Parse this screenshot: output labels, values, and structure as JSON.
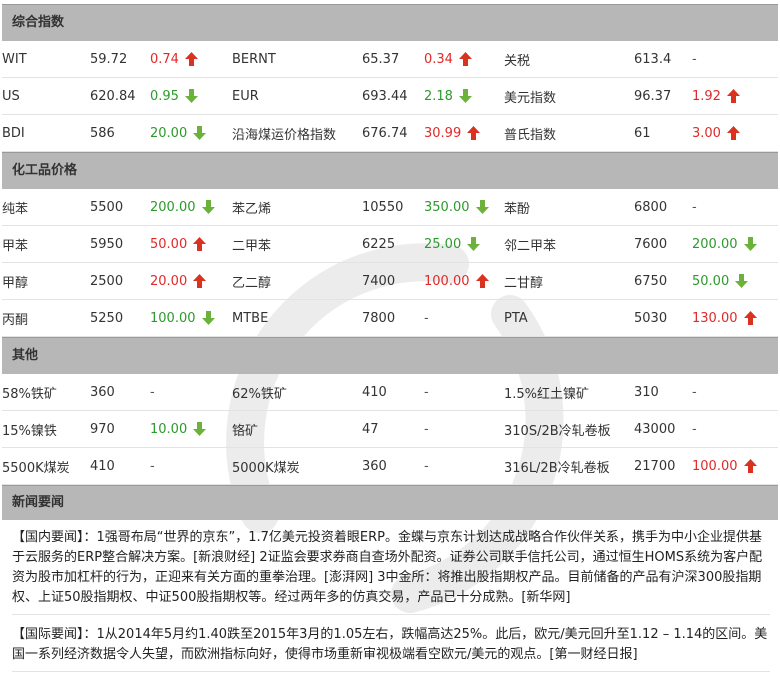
{
  "sections": {
    "composite": {
      "title": "综合指数",
      "rows": [
        [
          {
            "name": "WIT",
            "value": "59.72",
            "change": "0.74",
            "dir": "up"
          },
          {
            "name": "BERNT",
            "value": "65.37",
            "change": "0.34",
            "dir": "up"
          },
          {
            "name": "关税",
            "value": "613.4",
            "change": "-",
            "dir": "none"
          }
        ],
        [
          {
            "name": "US",
            "value": "620.84",
            "change": "0.95",
            "dir": "down"
          },
          {
            "name": "EUR",
            "value": "693.44",
            "change": "2.18",
            "dir": "down"
          },
          {
            "name": "美元指数",
            "value": "96.37",
            "change": "1.92",
            "dir": "up"
          }
        ],
        [
          {
            "name": "BDI",
            "value": "586",
            "change": "20.00",
            "dir": "down"
          },
          {
            "name": "沿海煤运价格指数",
            "value": "676.74",
            "change": "30.99",
            "dir": "up"
          },
          {
            "name": "普氏指数",
            "value": "61",
            "change": "3.00",
            "dir": "up"
          }
        ]
      ]
    },
    "chemicals": {
      "title": "化工品价格",
      "rows": [
        [
          {
            "name": "纯苯",
            "value": "5500",
            "change": "200.00",
            "dir": "down"
          },
          {
            "name": "苯乙烯",
            "value": "10550",
            "change": "350.00",
            "dir": "down"
          },
          {
            "name": "苯酚",
            "value": "6800",
            "change": "-",
            "dir": "none"
          }
        ],
        [
          {
            "name": "甲苯",
            "value": "5950",
            "change": "50.00",
            "dir": "up"
          },
          {
            "name": "二甲苯",
            "value": "6225",
            "change": "25.00",
            "dir": "down"
          },
          {
            "name": "邻二甲苯",
            "value": "7600",
            "change": "200.00",
            "dir": "down"
          }
        ],
        [
          {
            "name": "甲醇",
            "value": "2500",
            "change": "20.00",
            "dir": "up"
          },
          {
            "name": "乙二醇",
            "value": "7400",
            "change": "100.00",
            "dir": "up"
          },
          {
            "name": "二甘醇",
            "value": "6750",
            "change": "50.00",
            "dir": "down"
          }
        ],
        [
          {
            "name": "丙酮",
            "value": "5250",
            "change": "100.00",
            "dir": "down"
          },
          {
            "name": "MTBE",
            "value": "7800",
            "change": "-",
            "dir": "none"
          },
          {
            "name": "PTA",
            "value": "5030",
            "change": "130.00",
            "dir": "up"
          }
        ]
      ]
    },
    "other": {
      "title": "其他",
      "rows": [
        [
          {
            "name": "58%铁矿",
            "value": "360",
            "change": "-",
            "dir": "none"
          },
          {
            "name": "62%铁矿",
            "value": "410",
            "change": "-",
            "dir": "none"
          },
          {
            "name": "1.5%红土镍矿",
            "value": "310",
            "change": "-",
            "dir": "none"
          }
        ],
        [
          {
            "name": "15%镍铁",
            "value": "970",
            "change": "10.00",
            "dir": "down"
          },
          {
            "name": "铬矿",
            "value": "47",
            "change": "-",
            "dir": "none"
          },
          {
            "name": "310S/2B冷轧卷板",
            "value": "43000",
            "change": "-",
            "dir": "none"
          }
        ],
        [
          {
            "name": "5500K煤炭",
            "value": "410",
            "change": "-",
            "dir": "none"
          },
          {
            "name": "5000K煤炭",
            "value": "360",
            "change": "-",
            "dir": "none"
          },
          {
            "name": "316L/2B冷轧卷板",
            "value": "21700",
            "change": "100.00",
            "dir": "up"
          }
        ]
      ]
    }
  },
  "news": {
    "title": "新闻要闻",
    "paragraphs": [
      "【国内要闻】：1强哥布局“世界的京东”，1.7亿美元投资着眼ERP。金蝶与京东计划达成战略合作伙伴关系，携手为中小企业提供基于云服务的ERP整合解决方案。[新浪财经] 2证监会要求券商自查场外配资。证券公司联手信托公司，通过恒生HOMS系统为客户配资为股市加杠杆的行为，正迎来有关方面的重拳治理。[澎湃网] 3中金所：将推出股指期权产品。目前储备的产品有沪深300股指期权、上证50股指期权、中证500股指期权等。经过两年多的仿真交易，产品已十分成熟。[新华网]",
      "【国际要闻】：1从2014年5月约1.40跌至2015年3月的1.05左右，跌幅高达25%。此后，欧元/美元回升至1.12 – 1.14的区间。美国一系列经济数据令人失望，而欧洲指标向好，使得市场重新审视极端看空欧元/美元的观点。[第一财经日报]"
    ]
  },
  "colors": {
    "up": "#e02a2a",
    "down": "#2d9a2d",
    "header_bg": "#b7b7b7"
  },
  "icons": {
    "up": "red-up-arrow-icon",
    "down": "green-down-arrow-icon"
  }
}
